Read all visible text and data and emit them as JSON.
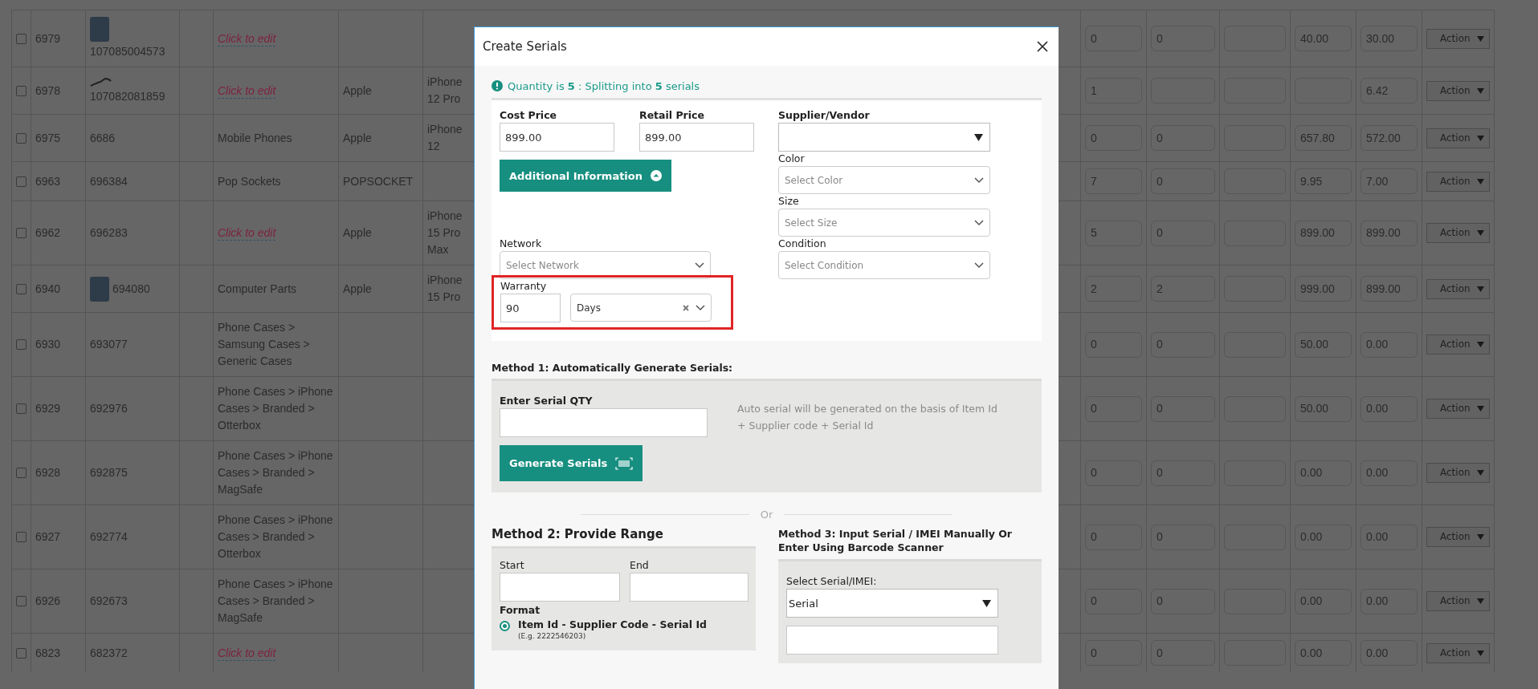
{
  "table": {
    "rows": [
      {
        "checked": false,
        "id": "6979",
        "sku": "107085004573",
        "thumbnail": {
          "kind": "stacked"
        },
        "category": {
          "kind": "link",
          "text": "Click to edit"
        },
        "field_1": "0",
        "field_2": "0",
        "field_4": "40.00",
        "field_5": "30.00",
        "action": "Action"
      },
      {
        "checked": false,
        "id": "6978",
        "sku": "107082081859",
        "thumbnail": {
          "kind": "cable"
        },
        "category": {
          "kind": "link",
          "text": "Click to edit"
        },
        "brand": "Apple",
        "model": "iPhone 12 Pro",
        "field_1": "1",
        "field_5": "6.42",
        "action": "Action"
      },
      {
        "checked": false,
        "id": "6975",
        "sku": "6686",
        "category": {
          "kind": "text",
          "text": "Mobile Phones"
        },
        "brand": "Apple",
        "model": "iPhone 12",
        "field_1": "0",
        "field_2": "0",
        "field_4": "657.80",
        "field_5": "572.00",
        "action": "Action"
      },
      {
        "checked": false,
        "id": "6963",
        "sku": "696384",
        "category": {
          "kind": "text",
          "text": "Pop Sockets"
        },
        "brand": "POPSOCKET",
        "field_1": "7",
        "field_2": "0",
        "field_4": "9.95",
        "field_5": "7.00",
        "action": "Action"
      },
      {
        "checked": false,
        "id": "6962",
        "sku": "696283",
        "category": {
          "kind": "link",
          "text": "Click to edit"
        },
        "brand": "Apple",
        "model": "iPhone 15 Pro Max",
        "field_1": "5",
        "field_2": "0",
        "field_4": "899.00",
        "field_5": "899.00",
        "action": "Action"
      },
      {
        "checked": false,
        "id": "6940",
        "sku": "694080",
        "thumbnail": {
          "kind": "inline"
        },
        "category": {
          "kind": "text",
          "text": "Computer Parts"
        },
        "brand": "Apple",
        "model": "iPhone 15 Pro",
        "field_1": "2",
        "field_2": "2",
        "field_4": "999.00",
        "field_5": "899.00",
        "action": "Action"
      },
      {
        "checked": false,
        "id": "6930",
        "sku": "693077",
        "category": {
          "kind": "text",
          "text": "Phone Cases > Samsung Cases > Generic Cases"
        },
        "field_1": "0",
        "field_2": "0",
        "field_4": "50.00",
        "field_5": "0.00",
        "action": "Action"
      },
      {
        "checked": false,
        "id": "6929",
        "sku": "692976",
        "category": {
          "kind": "text",
          "text": "Phone Cases > iPhone Cases > Branded > Otterbox"
        },
        "field_1": "0",
        "field_2": "0",
        "field_4": "50.00",
        "field_5": "0.00",
        "action": "Action"
      },
      {
        "checked": false,
        "id": "6928",
        "sku": "692875",
        "category": {
          "kind": "text",
          "text": "Phone Cases > iPhone Cases > Branded > MagSafe"
        },
        "field_1": "0",
        "field_2": "0",
        "field_4": "0.00",
        "field_5": "0.00",
        "action": "Action"
      },
      {
        "checked": false,
        "id": "6927",
        "sku": "692774",
        "category": {
          "kind": "text",
          "text": "Phone Cases > iPhone Cases > Branded > Otterbox"
        },
        "field_1": "0",
        "field_2": "0",
        "field_4": "0.00",
        "field_5": "0.00",
        "action": "Action"
      },
      {
        "checked": false,
        "id": "6926",
        "sku": "692673",
        "category": {
          "kind": "text",
          "text": "Phone Cases > iPhone Cases > Branded > MagSafe"
        },
        "field_1": "0",
        "field_2": "0",
        "field_4": "0.00",
        "field_5": "0.00",
        "action": "Action"
      },
      {
        "checked": false,
        "id": "6823",
        "sku": "682372",
        "category": {
          "kind": "link",
          "text": "Click to edit"
        },
        "field_1": "0",
        "field_2": "0",
        "field_4": "0.00",
        "field_5": "0.00",
        "action": "Action"
      }
    ]
  },
  "modal": {
    "title": "Create Serials",
    "notice": "Quantity is **5** : Splitting into **5** serials",
    "cost_price": {
      "label": "Cost Price",
      "value": "899.00"
    },
    "retail_price": {
      "label": "Retail Price",
      "value": "899.00"
    },
    "supplier": {
      "label": "Supplier/Vendor"
    },
    "additional_info_button": {
      "label": "Additional Information",
      "expanded": true
    },
    "color": {
      "label": "Color",
      "placeholder": "Select Color"
    },
    "size": {
      "label": "Size",
      "placeholder": "Select Size"
    },
    "network": {
      "label": "Network",
      "placeholder": "Select Network"
    },
    "condition": {
      "label": "Condition",
      "placeholder": "Select Condition"
    },
    "warranty": {
      "label": "Warranty",
      "value": "90",
      "unit": "Days",
      "highlighted": true
    },
    "method_1": {
      "title": "Method 1: Automatically Generate Serials:",
      "qty_label": "Enter Serial QTY",
      "hint": "Auto serial will be generated on the basis of Item Id + Supplier code + Serial Id",
      "button": "Generate Serials"
    },
    "divider": "Or",
    "method_2": {
      "title": "Method 2: Provide Range",
      "start_label": "Start",
      "end_label": "End",
      "format_label": "Format",
      "formats": [
        {
          "label": "Item Id - Supplier Code - Serial Id",
          "example": "(E.g. 2222546203)",
          "selected": true
        }
      ]
    },
    "method_3": {
      "title": "Method 3: Input Serial / IMEI Manually Or Enter Using Barcode Scanner",
      "select_label": "Select Serial/IMEI:",
      "select_value": "Serial"
    }
  }
}
